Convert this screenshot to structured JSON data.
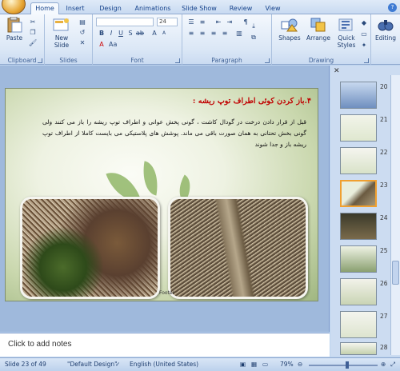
{
  "ribbon": {
    "tabs": [
      "Home",
      "Insert",
      "Design",
      "Animations",
      "Slide Show",
      "Review",
      "View"
    ],
    "groups": {
      "clipboard": "Clipboard",
      "slides": "Slides",
      "font": "Font",
      "paragraph": "Paragraph",
      "drawing": "Drawing",
      "editing": "Editing"
    },
    "buttons": {
      "paste": "Paste",
      "new_slide": "New Slide",
      "shapes": "Shapes",
      "arrange": "Arrange",
      "quick_styles": "Quick Styles",
      "editing": "Editing"
    },
    "font_size": "24"
  },
  "slide": {
    "title": "۴.باز کردن کوئی اطراف توپ ریشه :",
    "body": "قبل از قرار دادن درخت در گودال کاشت ، گونی پخش عوانی و اطراف توپ ریشه را باز می کنند ولی گونی بخش تحتانی به همان صورت باقی می ماند. پوشش های پلاستیکی می بایست کاملا از اطراف توپ ریشه باز و جدا شوند",
    "footer": "Footer"
  },
  "notes": {
    "placeholder": "Click to add notes"
  },
  "thumbnails": {
    "numbers": [
      "20",
      "21",
      "22",
      "23",
      "24",
      "25",
      "26",
      "27",
      "28"
    ],
    "selected": "23"
  },
  "status": {
    "slide_info": "Slide 23 of 49",
    "theme": "\"Default Design\"",
    "language": "English (United States)",
    "zoom": "79%"
  }
}
